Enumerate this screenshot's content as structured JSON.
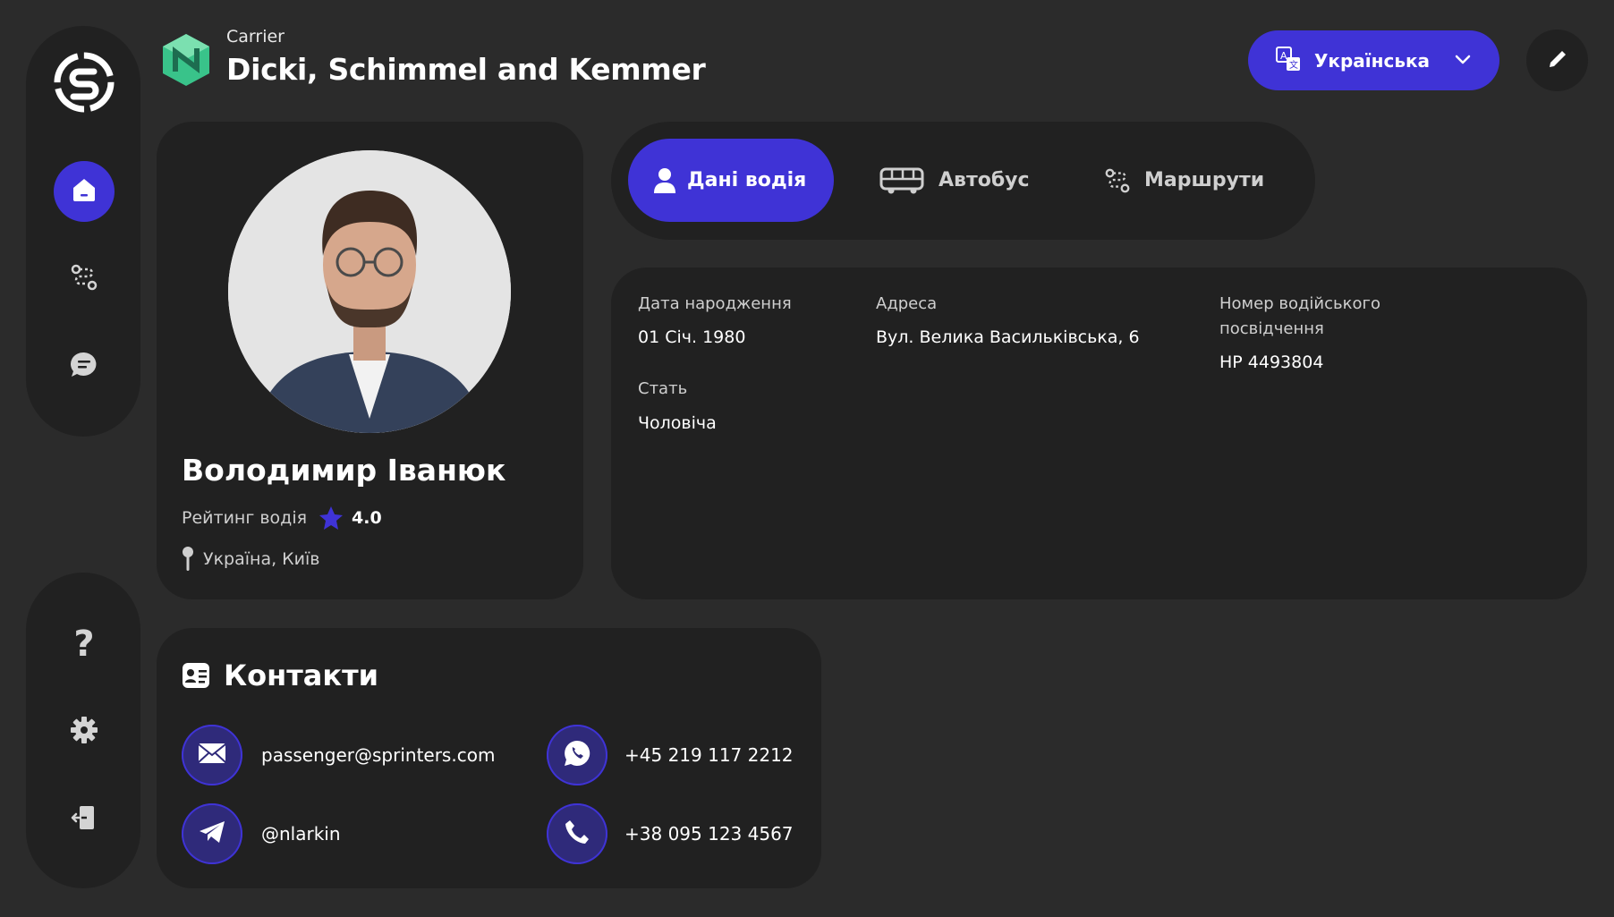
{
  "sidebar_bottom": {
    "help_label": "?"
  },
  "header": {
    "carrier_label": "Carrier",
    "company_name": "Dicki, Schimmel and Kemmer",
    "language": "Українська"
  },
  "profile": {
    "name": "Володимир Іванюк",
    "rating_label": "Рейтинг водія",
    "rating_value": "4.0",
    "location": "Україна, Київ"
  },
  "tabs": [
    {
      "label": "Дані водія",
      "active": true
    },
    {
      "label": "Автобус",
      "active": false
    },
    {
      "label": "Маршрути",
      "active": false
    }
  ],
  "details": {
    "birth_label": "Дата народження",
    "birth_value": "01 Січ. 1980",
    "address_label": "Адреса",
    "address_value": "Вул. Велика Васильківська, 6",
    "license_label": "Номер водійського посвідчення",
    "license_value": "НР 4493804",
    "gender_label": "Стать",
    "gender_value": "Чоловіча"
  },
  "contacts": {
    "title": "Контакти",
    "email": "passenger@sprinters.com",
    "whatsapp": "+45 219 117 2212",
    "telegram": "@nlarkin",
    "phone": "+38 095 123 4567"
  },
  "colors": {
    "accent": "#3f33d6",
    "bg": "#2b2b2b",
    "panel": "#212121"
  }
}
